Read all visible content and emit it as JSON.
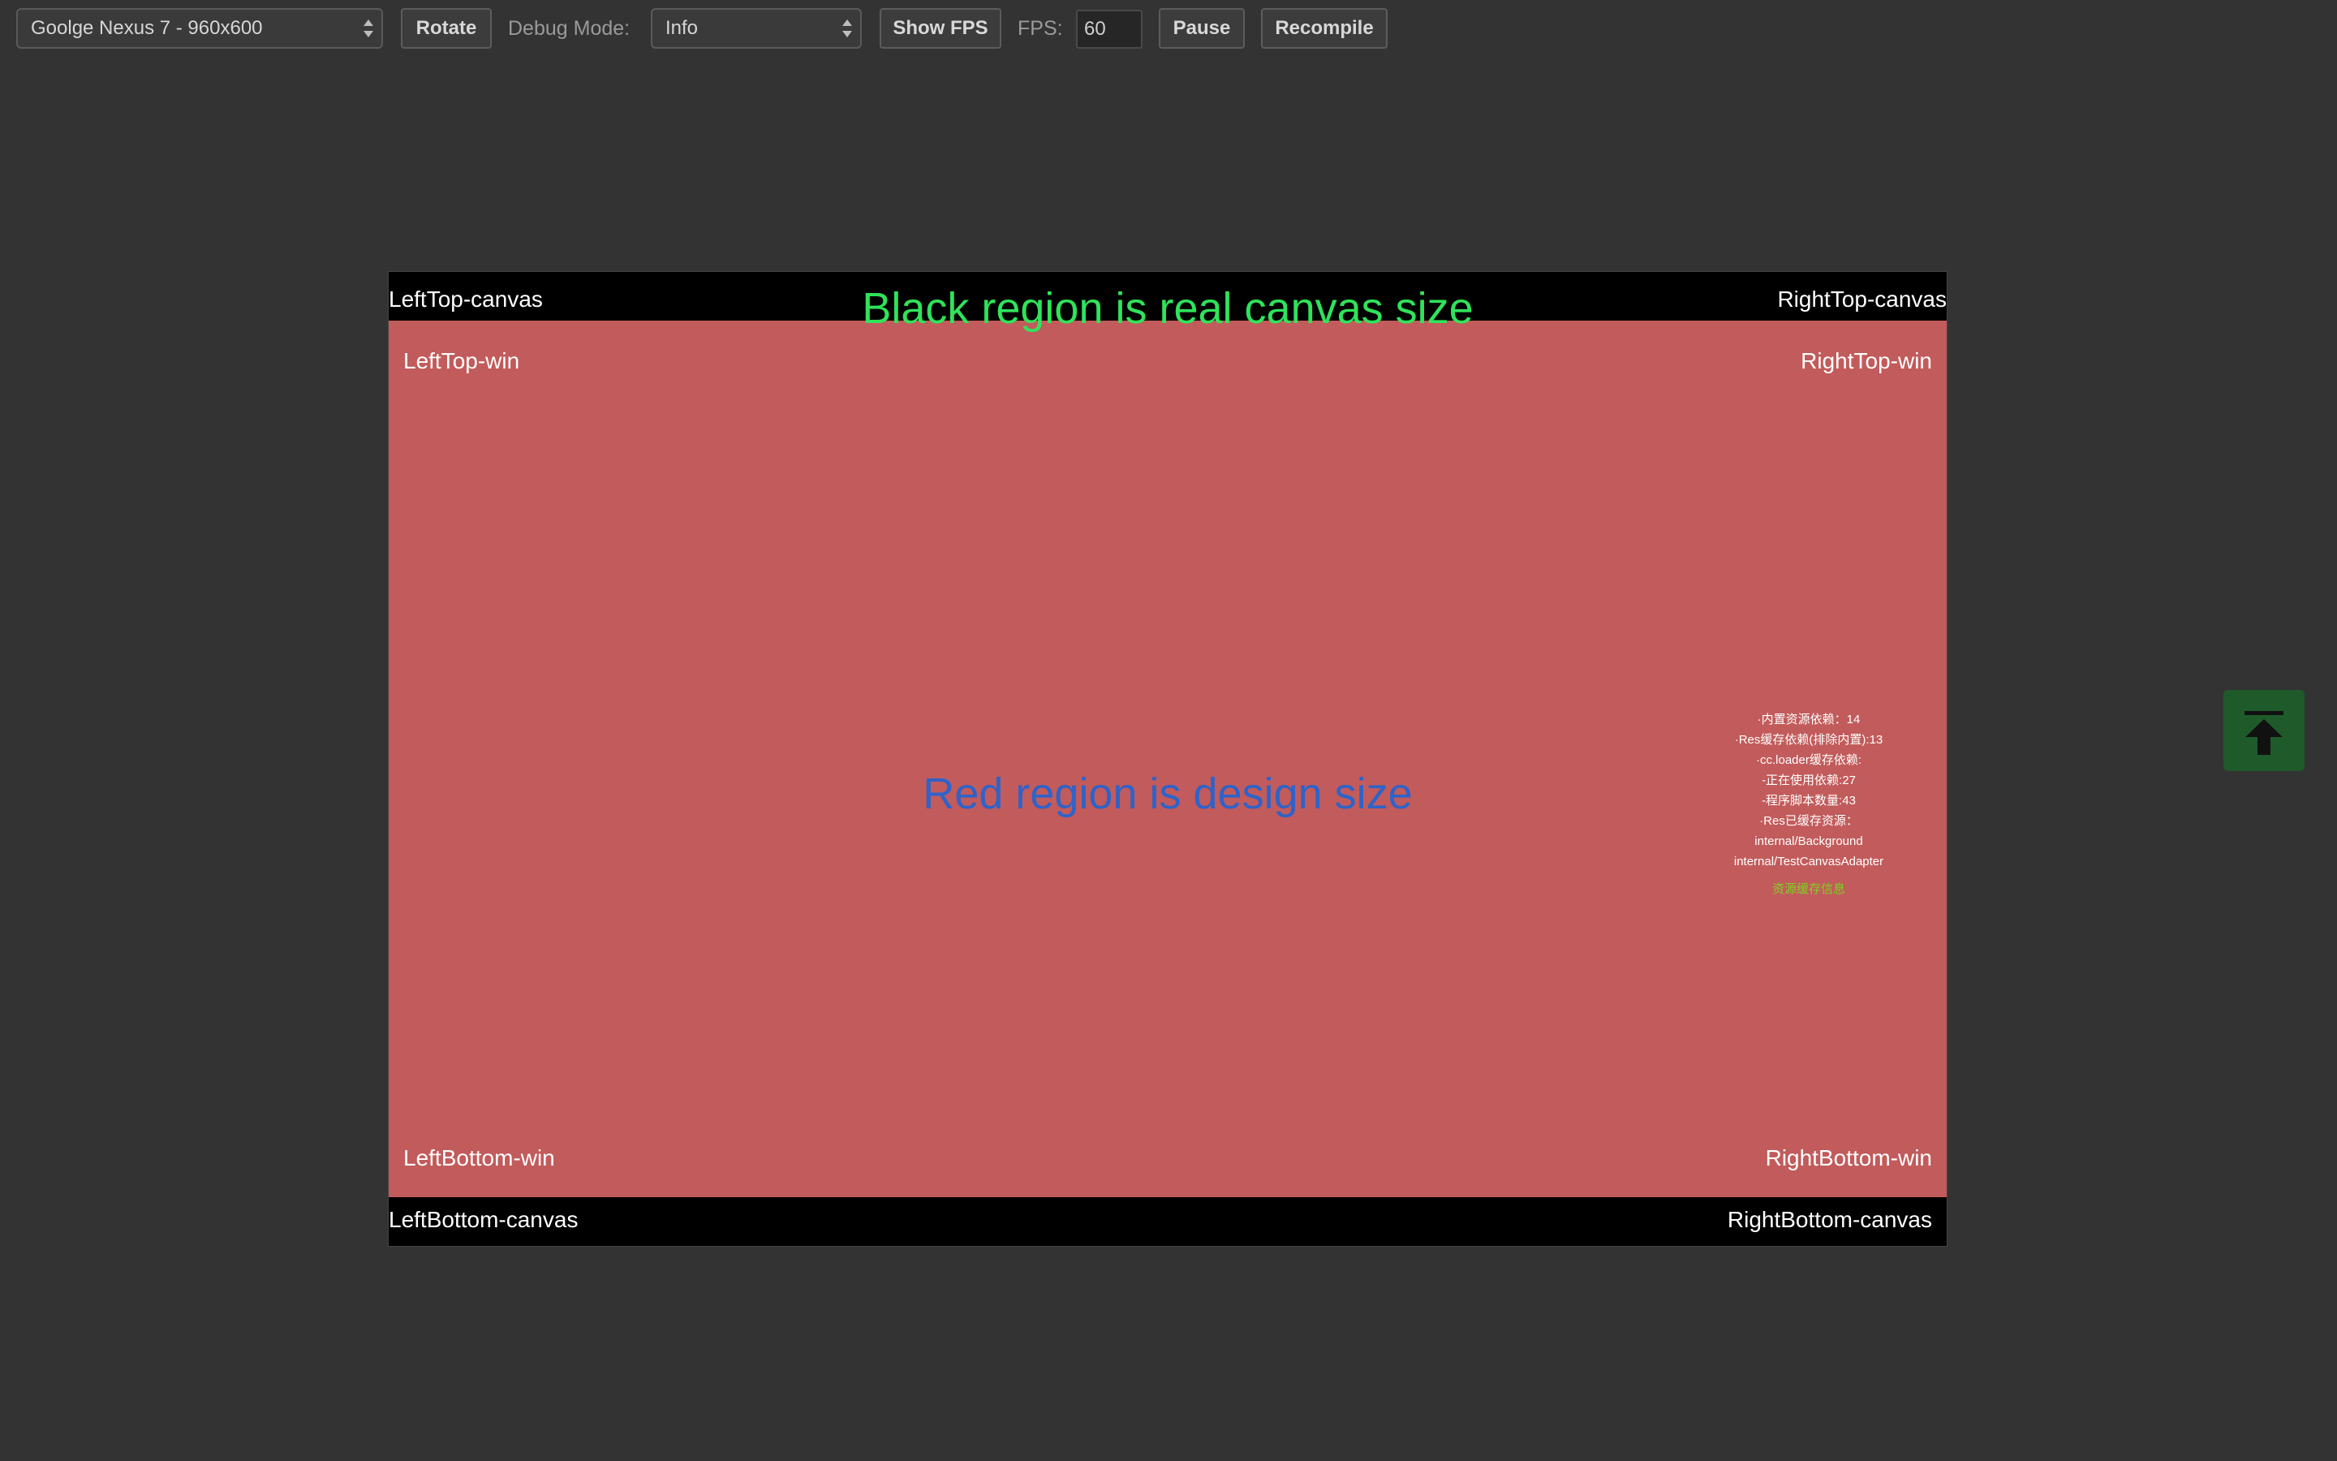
{
  "toolbar": {
    "device_select": "Goolge Nexus 7 - 960x600",
    "rotate_label": "Rotate",
    "debug_mode_label": "Debug Mode:",
    "debug_mode_select": "Info",
    "show_fps_label": "Show FPS",
    "fps_label": "FPS:",
    "fps_value": "60",
    "pause_label": "Pause",
    "recompile_label": "Recompile"
  },
  "canvas": {
    "top_left": "LeftTop-canvas",
    "top_right": "RightTop-canvas",
    "bottom_left": "LeftBottom-canvas",
    "bottom_right": "RightBottom-canvas",
    "headline": "Black region is real canvas size"
  },
  "design": {
    "top_left": "LeftTop-win",
    "top_right": "RightTop-win",
    "bottom_left": "LeftBottom-win",
    "bottom_right": "RightBottom-win",
    "headline": "Red region is design size"
  },
  "debug_info": {
    "lines": [
      "·内置资源依赖：14",
      "·Res缓存依赖(排除内置):13",
      "·cc.loader缓存依赖:",
      "-正在使用依赖:27",
      "-程序脚本数量:43",
      "·Res已缓存资源：",
      "internal/Background",
      "internal/TestCanvasAdapter"
    ],
    "footer": "资源缓存信息"
  },
  "colors": {
    "background": "#333333",
    "canvas": "#000000",
    "design": "#c25b5b",
    "canvas_headline": "#2fe35a",
    "design_headline": "#2e63c9",
    "debug_footer": "#7ed321",
    "scroll_button": "#1f5b2a"
  },
  "icons": {
    "scroll_top": "arrow-up-to-line-icon"
  }
}
